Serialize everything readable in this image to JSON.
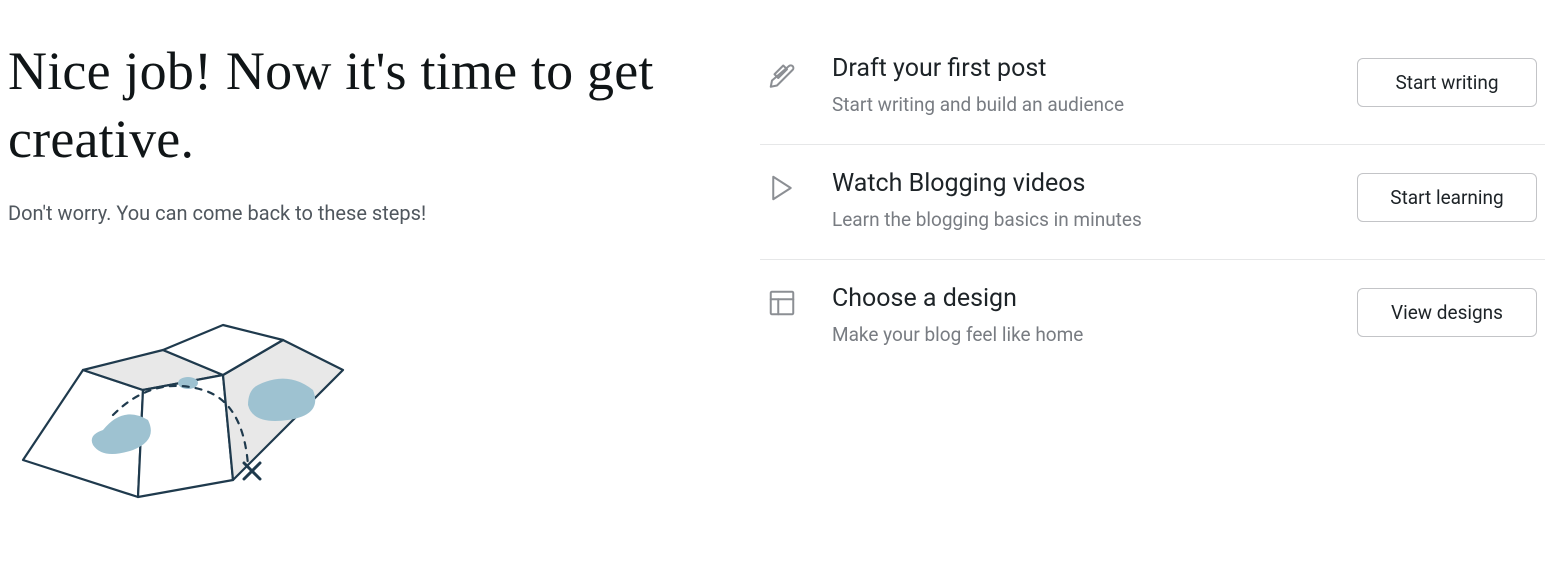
{
  "hero": {
    "headline": "Nice job! Now it's time to get creative.",
    "subhead": "Don't worry. You can come back to these steps!"
  },
  "tasks": [
    {
      "title": "Draft your first post",
      "desc": "Start writing and build an audience",
      "cta": "Start writing"
    },
    {
      "title": "Watch Blogging videos",
      "desc": "Learn the blogging basics in minutes",
      "cta": "Start learning"
    },
    {
      "title": "Choose a design",
      "desc": "Make your blog feel like home",
      "cta": "View designs"
    }
  ]
}
